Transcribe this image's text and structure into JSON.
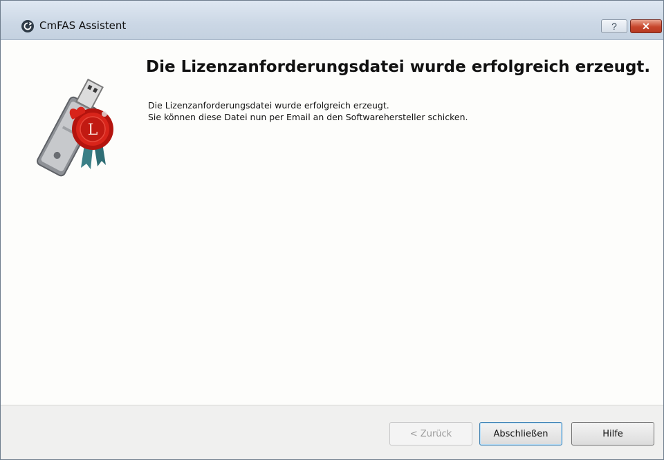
{
  "window": {
    "title": "CmFAS Assistent",
    "help_glyph": "?",
    "close_glyph": "✕",
    "app_icon": "cmfas-app-icon"
  },
  "content": {
    "heading": "Die Lizenzanforderungsdatei wurde erfolgreich erzeugt.",
    "message_line1": "Die Lizenzanforderungsdatei wurde erfolgreich erzeugt.",
    "message_line2": "Sie können diese Datei nun per Email an den Softwarehersteller schicken.",
    "illustration": "usb-dongle-with-license-seal",
    "seal_letter": "L"
  },
  "footer": {
    "back_label": "< Zurück",
    "finish_label": "Abschließen",
    "help_label": "Hilfe"
  },
  "colors": {
    "titlebar": "#cbd7e5",
    "close_button": "#c7462c",
    "seal_red": "#d11a12",
    "disabled_text": "#9a9a9a",
    "default_button_border": "#3c7fb1"
  }
}
